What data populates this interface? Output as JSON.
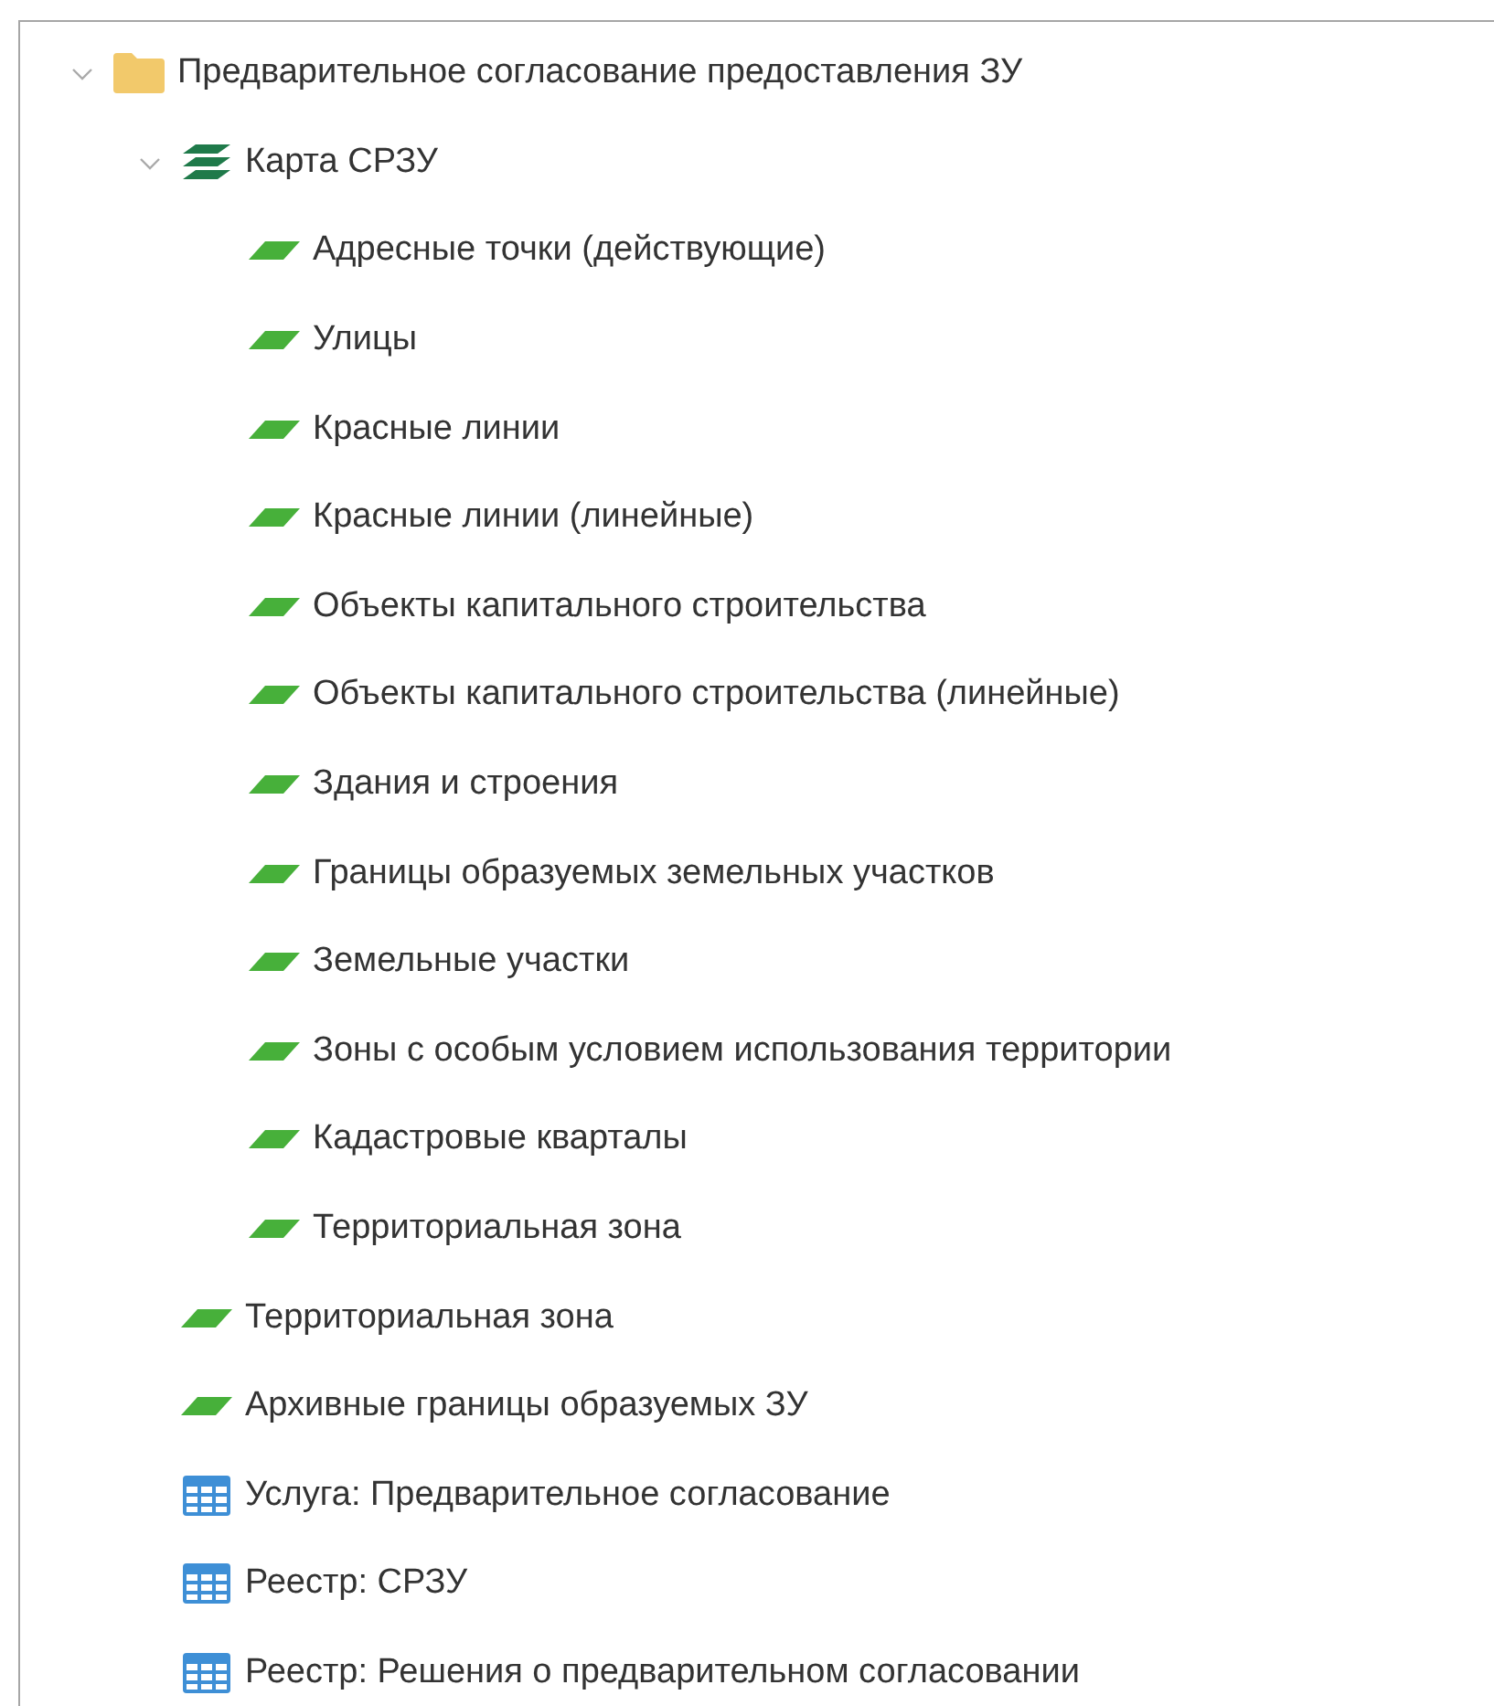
{
  "tree": [
    {
      "label": "Предварительное согласование предоставления ЗУ",
      "kind": "folder",
      "expanded": true,
      "children": [
        {
          "label": "Карта СРЗУ",
          "kind": "layers",
          "expanded": true,
          "children": [
            {
              "label": "Адресные точки (действующие)",
              "kind": "layer"
            },
            {
              "label": "Улицы",
              "kind": "layer"
            },
            {
              "label": "Красные линии",
              "kind": "layer"
            },
            {
              "label": "Красные линии (линейные)",
              "kind": "layer"
            },
            {
              "label": "Объекты капитального строительства",
              "kind": "layer"
            },
            {
              "label": "Объекты капитального строительства (линейные)",
              "kind": "layer"
            },
            {
              "label": "Здания и строения",
              "kind": "layer"
            },
            {
              "label": "Границы образуемых земельных участков",
              "kind": "layer"
            },
            {
              "label": "Земельные участки",
              "kind": "layer"
            },
            {
              "label": "Зоны с особым условием использования территории",
              "kind": "layer"
            },
            {
              "label": "Кадастровые кварталы",
              "kind": "layer"
            },
            {
              "label": "Территориальная зона",
              "kind": "layer"
            }
          ]
        },
        {
          "label": "Территориальная зона",
          "kind": "layer"
        },
        {
          "label": "Архивные границы образуемых ЗУ",
          "kind": "layer"
        },
        {
          "label": "Услуга: Предварительное согласование",
          "kind": "table"
        },
        {
          "label": "Реестр: СРЗУ",
          "kind": "table"
        },
        {
          "label": "Реестр: Решения о предварительном согласовании",
          "kind": "table"
        }
      ]
    }
  ]
}
